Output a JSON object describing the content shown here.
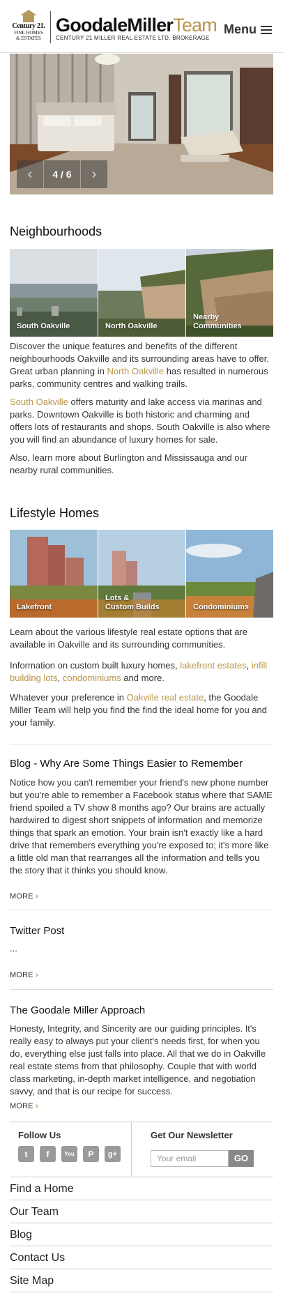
{
  "header": {
    "c21_word": "Century 21.",
    "c21_sub1": "FINE HOMES",
    "c21_sub2": "& ESTATES",
    "brand_main": "GoodaleMiller",
    "brand_accent": "Team",
    "brand_sub": "CENTURY 21 MILLER REAL ESTATE LTD. BROKERAGE",
    "menu_label": "Menu",
    "menu_icon": "hamburger-icon"
  },
  "hero": {
    "counter": "4 / 6",
    "prev_icon": "chevron-left-icon",
    "next_icon": "chevron-right-icon"
  },
  "neighbourhoods": {
    "title": "Neighbourhoods",
    "tiles": [
      "South Oakville",
      "North Oakville",
      "Nearby\nCommunities"
    ],
    "p1_a": "Discover the unique features and benefits of the different neighbourhoods Oakville and its surrounding areas have to offer. Great urban planning in ",
    "p1_link": "North Oakville",
    "p1_b": " has resulted in numerous parks, community centres and walking trails.",
    "p2_link": "South Oakville",
    "p2_b": " offers maturity and lake access via marinas and parks.  Downtown Oakville is both historic and charming and offers lots of restaurants and shops.  South Oakville is also where you will find an abundance of luxury homes for sale.",
    "p3": "Also, learn more about Burlington and Mississauga and our nearby rural communities."
  },
  "lifestyle": {
    "title": "Lifestyle Homes",
    "tiles": [
      "Lakefront",
      "Lots &\nCustom Builds",
      "Condominiums"
    ],
    "p1": "Learn about the various lifestyle real estate options that are available in Oakville and its surrounding communities.",
    "p2_a": "Information on custom built luxury homes, ",
    "p2_link1": "lakefront estates",
    "p2_sep": ", ",
    "p2_link2": "infill building lots",
    "p2_sep2": ", ",
    "p2_link3": "condominiums",
    "p2_b": " and more.",
    "p3_a": "Whatever your preference in ",
    "p3_link": "Oakville real estate",
    "p3_b": ", the Goodale Miller Team will help you find the find the ideal home for you and your family."
  },
  "posts": [
    {
      "title": "Blog - Why Are Some Things Easier to Remember",
      "body": "Notice how you can't remember your friend's new phone number but you're able to remember a Facebook status where that SAME friend spoiled a TV show 8 months ago? Our brains are actually hardwired to digest short snippets of information and memorize things that spark an emotion. Your brain isn't exactly like a hard drive that remembers everything you're exposed to; it's more like a little old man that rearranges all the information and tells you the story that it thinks you should know.",
      "more": "MORE"
    },
    {
      "title": "Twitter Post",
      "body": "...",
      "more": "MORE"
    },
    {
      "title": "The Goodale Miller Approach",
      "body": "Honesty, Integrity, and Sincerity are our guiding principles. It's really easy to always put your client's needs first, for when you do, everything else just falls into place. All that we do in Oakville real estate stems from that philosophy. Couple that with world class marketing, in-depth market intelligence, and negotiation savvy, and that is our recipe for success.",
      "more": "MORE"
    }
  ],
  "footer": {
    "follow_title": "Follow Us",
    "social": [
      {
        "icon": "twitter-icon",
        "glyph": "t"
      },
      {
        "icon": "facebook-icon",
        "glyph": "f"
      },
      {
        "icon": "youtube-icon",
        "glyph": "You"
      },
      {
        "icon": "pinterest-icon",
        "glyph": "P"
      },
      {
        "icon": "google-plus-icon",
        "glyph": "g+"
      }
    ],
    "newsletter_title": "Get Our Newsletter",
    "email_placeholder": "Your email",
    "go_label": "GO",
    "nav": [
      "Find a Home",
      "Our Team",
      "Blog",
      "Contact Us",
      "Site Map"
    ]
  },
  "colors": {
    "accent": "#b8954a",
    "text": "#333333",
    "rule": "#dddddd"
  }
}
